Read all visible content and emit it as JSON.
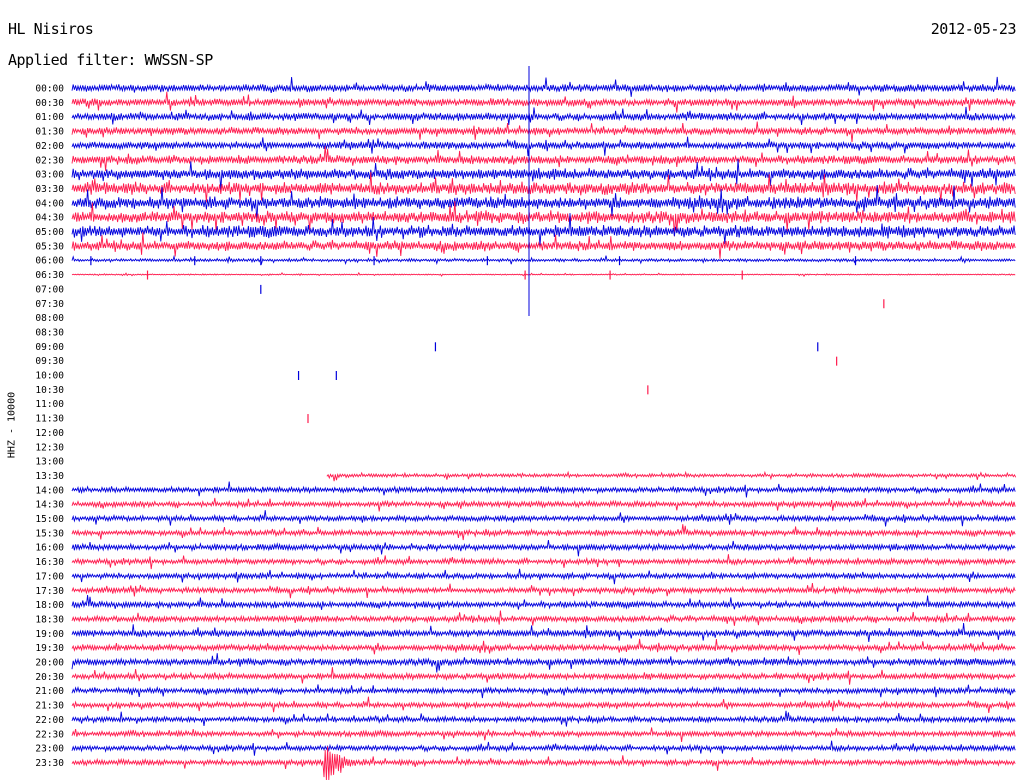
{
  "header": {
    "station": "HL Nisiros",
    "date": "2012-05-23",
    "filter": "Applied filter: WWSSN-SP"
  },
  "chart_data": {
    "type": "line",
    "title": "HL Nisiros",
    "ylabel": "HHZ - 10000",
    "row_labels": [
      "00:00",
      "00:30",
      "01:00",
      "01:30",
      "02:00",
      "02:30",
      "03:00",
      "03:30",
      "04:00",
      "04:30",
      "05:00",
      "05:30",
      "06:00",
      "06:30",
      "07:00",
      "07:30",
      "08:00",
      "08:30",
      "09:00",
      "09:30",
      "10:00",
      "10:30",
      "11:00",
      "11:30",
      "12:00",
      "12:30",
      "13:00",
      "13:30",
      "14:00",
      "14:30",
      "15:00",
      "15:30",
      "16:00",
      "16:30",
      "17:00",
      "17:30",
      "18:00",
      "18:30",
      "19:00",
      "19:30",
      "20:00",
      "20:30",
      "21:00",
      "21:30",
      "22:00",
      "22:30",
      "23:00",
      "23:30"
    ],
    "colors": {
      "odd_rows": "#0000dd",
      "even_rows": "#ff1a4d"
    },
    "series_amplitude": [
      0.6,
      0.6,
      0.6,
      0.6,
      0.6,
      0.7,
      0.9,
      1.0,
      1.0,
      1.0,
      1.0,
      0.8,
      0.25,
      0.1,
      0,
      0,
      0,
      0,
      0,
      0,
      0,
      0,
      0,
      0,
      0,
      0,
      0,
      0.3,
      0.45,
      0.45,
      0.45,
      0.45,
      0.5,
      0.45,
      0.45,
      0.45,
      0.5,
      0.5,
      0.55,
      0.5,
      0.55,
      0.5,
      0.45,
      0.45,
      0.45,
      0.45,
      0.45,
      0.45
    ],
    "data_start_fraction_row_13_30": 0.27,
    "events": [
      {
        "row": "23:30",
        "time_fraction": 0.27,
        "amplitude": 3.0
      },
      {
        "row": "07:30",
        "time_fraction": 0.47,
        "amplitude": 1.5
      }
    ]
  }
}
